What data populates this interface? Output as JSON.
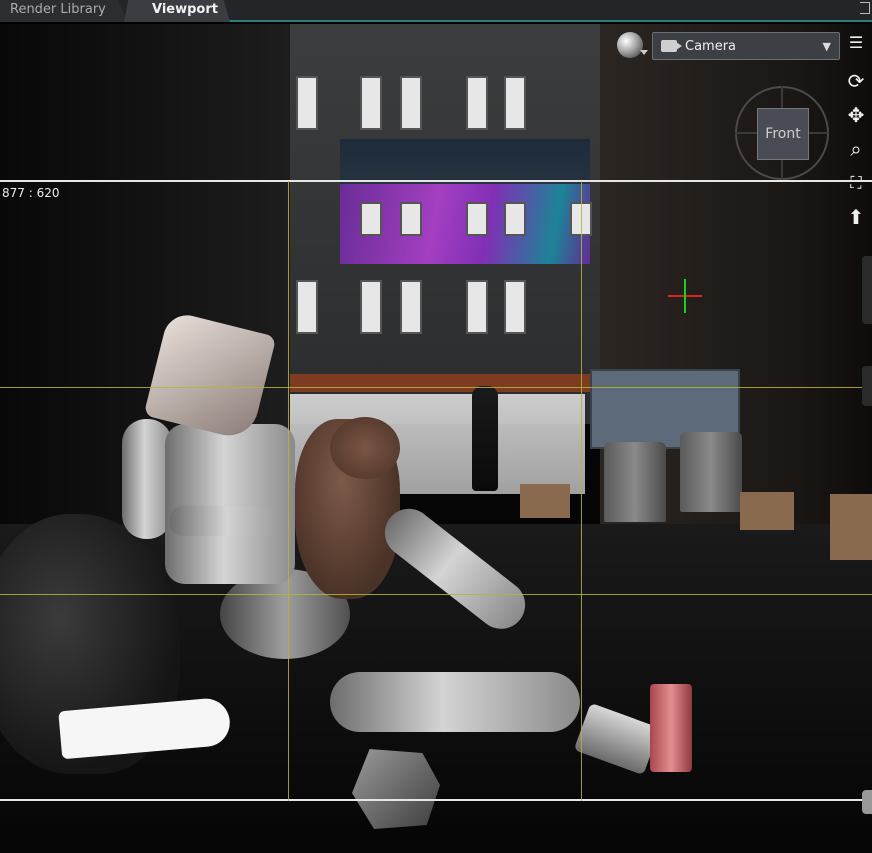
{
  "tabs": [
    {
      "label": "Render Library"
    },
    {
      "label": "Viewport"
    }
  ],
  "viewport": {
    "aspect_readout": "877 : 620",
    "camera_select": {
      "value": "Camera"
    },
    "view_cube": {
      "face_label": "Front"
    }
  },
  "icons": {
    "camera": "camera-icon",
    "chevron": "chevron-down-icon",
    "draw_style": "sphere-icon",
    "menu": "menu-icon",
    "orbit": "orbit-icon",
    "pan": "move-icon",
    "zoom": "zoom-icon",
    "frame": "frame-icon",
    "align": "arrow-up-icon"
  },
  "colors": {
    "tab_accent": "#2f7d7a",
    "guide_lines": "#b7b437",
    "safe_frame": "#e6e6e6"
  }
}
